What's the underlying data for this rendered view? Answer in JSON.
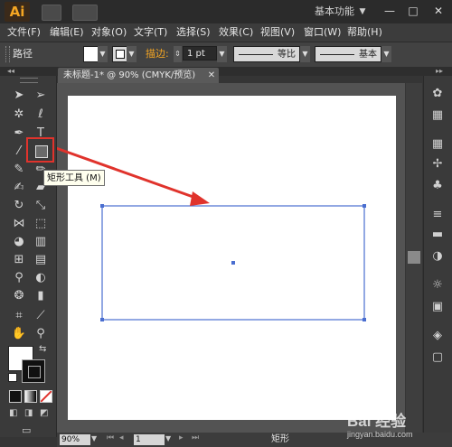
{
  "app": {
    "logo_text": "Ai",
    "workspace_label": "基本功能",
    "window_controls": [
      "minimize",
      "maximize",
      "close"
    ]
  },
  "menu": {
    "items": [
      "文件(F)",
      "编辑(E)",
      "对象(O)",
      "文字(T)",
      "选择(S)",
      "效果(C)",
      "视图(V)",
      "窗口(W)",
      "帮助(H)"
    ]
  },
  "control_bar": {
    "selection_label": "路径",
    "stroke_label": "描边:",
    "stroke_weight": "1 pt",
    "profile_label": "等比",
    "brush_label": "基本",
    "fill_color": "#ffffff",
    "accent_color": "#f5a623"
  },
  "document": {
    "tab_title": "未标题-1* @ 90% (CMYK/预览)",
    "zoom": "90%",
    "page": "1",
    "status_tool": "矩形"
  },
  "tooltip": {
    "text": "矩形工具 (M)"
  },
  "annotation": {
    "highlight_color": "#e0332c",
    "arrow_color": "#e0332c"
  },
  "watermark": {
    "text": "Bai 经验",
    "url": "jingyan.baidu.com"
  },
  "icons": {
    "tools": [
      "selection-icon",
      "direct-selection-icon",
      "magic-wand-icon",
      "lasso-icon",
      "pen-icon",
      "type-icon",
      "line-segment-icon",
      "rectangle-icon",
      "paintbrush-icon",
      "pencil-icon",
      "blob-brush-icon",
      "eraser-icon",
      "rotate-icon",
      "scale-icon",
      "width-icon",
      "free-transform-icon",
      "shape-builder-icon",
      "perspective-grid-icon",
      "mesh-icon",
      "gradient-icon",
      "eyedropper-icon",
      "blend-icon",
      "symbol-sprayer-icon",
      "column-graph-icon",
      "artboard-icon",
      "slice-icon",
      "hand-icon",
      "zoom-icon"
    ],
    "right_panel": [
      "color-icon",
      "color-guide-icon",
      "swatches-icon",
      "brushes-icon",
      "symbols-icon",
      "stroke-icon",
      "gradient-panel-icon",
      "transparency-icon",
      "appearance-icon",
      "graphic-styles-icon",
      "layers-icon",
      "artboards-panel-icon"
    ]
  }
}
